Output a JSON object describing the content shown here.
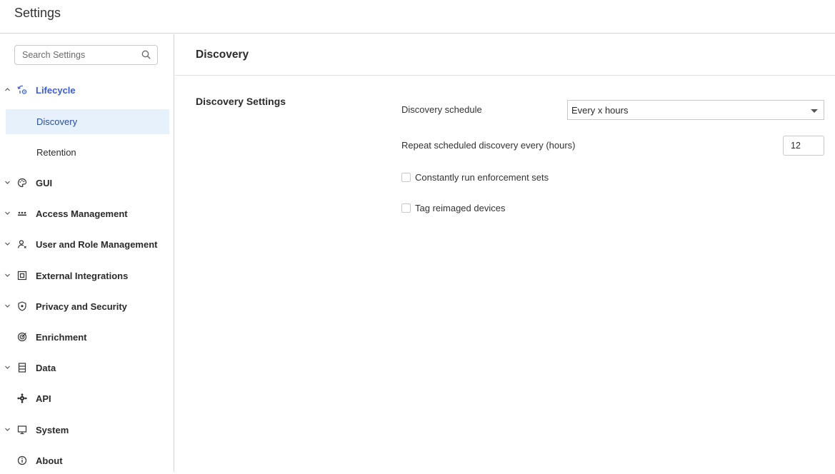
{
  "app": {
    "title": "Settings"
  },
  "search": {
    "placeholder": "Search Settings",
    "icon": "search-icon"
  },
  "sidebar": {
    "items": [
      {
        "label": "Lifecycle",
        "icon": "lifecycle-icon",
        "expanded": true,
        "children": [
          {
            "label": "Discovery",
            "active": true
          },
          {
            "label": "Retention"
          }
        ]
      },
      {
        "label": "GUI",
        "icon": "palette-icon"
      },
      {
        "label": "Access Management",
        "icon": "access-icon"
      },
      {
        "label": "User and Role Management",
        "icon": "user-role-icon"
      },
      {
        "label": "External Integrations",
        "icon": "integration-icon"
      },
      {
        "label": "Privacy and Security",
        "icon": "shield-icon"
      },
      {
        "label": "Enrichment",
        "icon": "enrichment-icon"
      },
      {
        "label": "Data",
        "icon": "data-icon"
      },
      {
        "label": "API",
        "icon": "api-icon"
      },
      {
        "label": "System",
        "icon": "monitor-icon"
      },
      {
        "label": "About",
        "icon": "info-icon"
      }
    ]
  },
  "main": {
    "title": "Discovery",
    "section_title": "Discovery Settings",
    "schedule": {
      "label": "Discovery schedule",
      "value": "Every x hours"
    },
    "repeat": {
      "label": "Repeat scheduled discovery every (hours)",
      "value": "12"
    },
    "checkboxes": [
      {
        "label": "Constantly run enforcement sets",
        "checked": false
      },
      {
        "label": "Tag reimaged devices",
        "checked": false
      }
    ]
  },
  "colors": {
    "accent": "#3b5bdb",
    "active_bg": "#e6f1fc",
    "border": "#d4d4d4"
  }
}
